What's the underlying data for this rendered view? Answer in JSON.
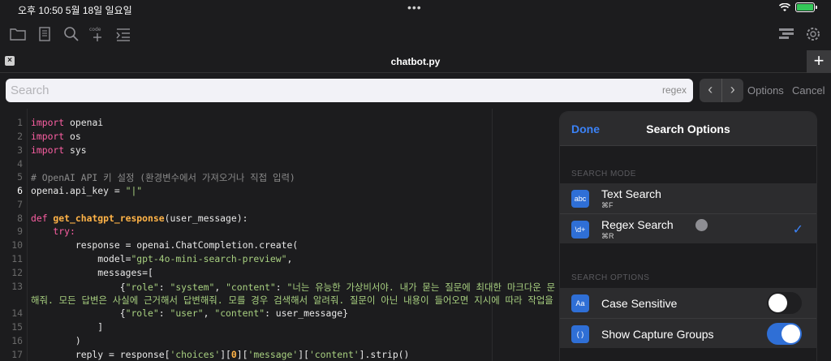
{
  "status": {
    "time": "오후 10:50   5월 18일 일요일",
    "dots": "•••"
  },
  "toolbar": {
    "icons_left": [
      "folder-icon",
      "scroll-icon",
      "search-icon",
      "code-insert-icon",
      "indent-icon"
    ],
    "icons_right": [
      "layout-icon",
      "gear-icon"
    ],
    "code_label": "code"
  },
  "tab": {
    "close": "×",
    "title": "chatbot.py",
    "add": "+"
  },
  "search": {
    "placeholder": "Search",
    "mode_tag": "regex",
    "prev": "‹",
    "next": "›",
    "options": "Options",
    "cancel": "Cancel"
  },
  "editor": {
    "gutter": [
      "1",
      "2",
      "3",
      "4",
      "5",
      "6",
      "7",
      "8",
      "9",
      "10",
      "11",
      "12",
      "13",
      "",
      "14",
      "15",
      "16",
      "17"
    ],
    "active_line": "6"
  },
  "code": {
    "l1_kw": "import",
    "l1_rest": " openai",
    "l2_kw": "import",
    "l2_rest": " os",
    "l3_kw": "import",
    "l3_rest": " sys",
    "l5": "# OpenAI API 키 설정 (환경변수에서 가져오거나 직접 입력)",
    "l6_a": "openai.api_key = ",
    "l6_str": "\"|\"",
    "l8_kw": "def",
    "l8_fn": " get_chatgpt_response",
    "l8_rest": "(user_message):",
    "l9_kw": "    try:",
    "l10": "        response = openai.ChatCompletion.create(",
    "l11_a": "            model=",
    "l11_str": "\"gpt-4o-mini-search-preview\"",
    "l11_b": ",",
    "l12": "            messages=[",
    "l13_a": "                {",
    "l13_s1": "\"role\"",
    "l13_b": ": ",
    "l13_s2": "\"system\"",
    "l13_c": ", ",
    "l13_s3": "\"content\"",
    "l13_d": ": ",
    "l13_s4": "\"너는 유능한 가상비서야. 내가 묻는 질문에 최대한 마크다운 문",
    "l13w": "해줘. 모든 답변은 사실에 근거해서 답변해줘. 모를 경우 검색해서 알려줘. 질문이 아닌 내용이 들어오면 지시에 따라 작업을 수",
    "l14_a": "                {",
    "l14_s1": "\"role\"",
    "l14_b": ": ",
    "l14_s2": "\"user\"",
    "l14_c": ", ",
    "l14_s3": "\"content\"",
    "l14_d": ": user_message}",
    "l15": "            ]",
    "l16": "        )",
    "l17_a": "        reply = response[",
    "l17_s1": "'choices'",
    "l17_b": "][",
    "l17_n": "0",
    "l17_c": "][",
    "l17_s2": "'message'",
    "l17_d": "][",
    "l17_s3": "'content'",
    "l17_e": "].strip()"
  },
  "popover": {
    "done": "Done",
    "title": "Search Options",
    "mode_label": "SEARCH MODE",
    "options_label": "SEARCH OPTIONS",
    "text_search": {
      "icon": "abc",
      "title": "Text Search",
      "shortcut": "⌘F",
      "selected": false
    },
    "regex_search": {
      "icon": "\\d+",
      "title": "Regex Search",
      "shortcut": "⌘R",
      "selected": true
    },
    "case_sensitive": {
      "icon": "Aa",
      "title": "Case Sensitive",
      "on": false
    },
    "capture_groups": {
      "icon": "( )",
      "title": "Show Capture Groups",
      "on": true
    },
    "check": "✓"
  },
  "colors": {
    "accent": "#3b82f6",
    "keyword": "#fc5fa3",
    "string": "#a8d080",
    "function": "#ffb347",
    "comment": "#8a8a8a"
  }
}
